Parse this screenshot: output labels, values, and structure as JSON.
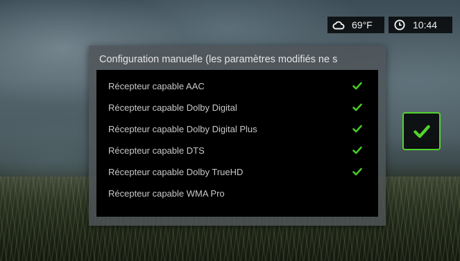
{
  "status_bar": {
    "weather": {
      "icon": "cloud-icon",
      "temperature": "69°F"
    },
    "clock": {
      "icon": "clock-icon",
      "time": "10:44"
    }
  },
  "dialog": {
    "title": "Configuration manuelle (les paramètres modifiés ne s",
    "items": [
      {
        "label": "Récepteur capable AAC",
        "checked": true
      },
      {
        "label": "Récepteur capable Dolby Digital",
        "checked": true
      },
      {
        "label": "Récepteur capable Dolby Digital Plus",
        "checked": true
      },
      {
        "label": "Récepteur capable DTS",
        "checked": true
      },
      {
        "label": "Récepteur capable Dolby TrueHD",
        "checked": true
      },
      {
        "label": "Récepteur capable WMA Pro",
        "checked": false
      }
    ]
  },
  "confirm_button": {
    "icon": "checkmark-icon"
  },
  "colors": {
    "accent_green": "#53d42e",
    "check_green": "#48c926",
    "list_background": "#000000",
    "dialog_background": "#4e5458"
  }
}
